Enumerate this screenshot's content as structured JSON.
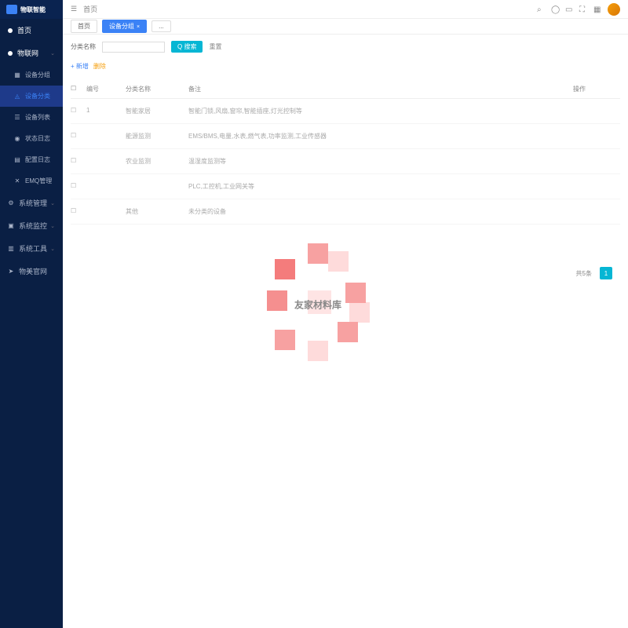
{
  "logo": {
    "text": "物联智能"
  },
  "sidebar": {
    "home": "首页",
    "iot": "物联网",
    "sub1": "设备分组",
    "sub2": "设备分类",
    "sub3": "设备列表",
    "sub4": "状态日志",
    "sub5": "配置日志",
    "sub6": "EMQ管理",
    "sys1": "系统管理",
    "sys2": "系统监控",
    "sys3": "系统工具",
    "sys4": "物美官网"
  },
  "header": {
    "breadcrumb": "首页"
  },
  "tabs": {
    "t1": "首页",
    "t2": "设备分组",
    "t3": "..."
  },
  "toolbar": {
    "label": "分类名称",
    "search": "Q 搜索",
    "reset": "重置"
  },
  "actions": {
    "add": "+ 新增",
    "del": "删除"
  },
  "table": {
    "headers": {
      "id": "编号",
      "name": "分类名称",
      "desc": "备注",
      "action": "操作"
    },
    "rows": [
      {
        "id": "1",
        "name": "智能家居",
        "desc": "智能门锁,风扇,窗帘,智能插座,灯光控制等",
        "action": ""
      },
      {
        "id": "",
        "name": "能源监测",
        "desc": "EMS/BMS,电量,水表,燃气表,功率监测,工业传感器",
        "action": ""
      },
      {
        "id": "",
        "name": "农业监测",
        "desc": "温湿度监测等",
        "action": ""
      },
      {
        "id": "",
        "name": "",
        "desc": "PLC,工控机,工业网关等",
        "action": ""
      },
      {
        "id": "",
        "name": "其他",
        "desc": "未分类的设备",
        "action": ""
      }
    ]
  },
  "pagination": {
    "total": "共5条",
    "page": "1"
  },
  "watermark": "友家材料库"
}
